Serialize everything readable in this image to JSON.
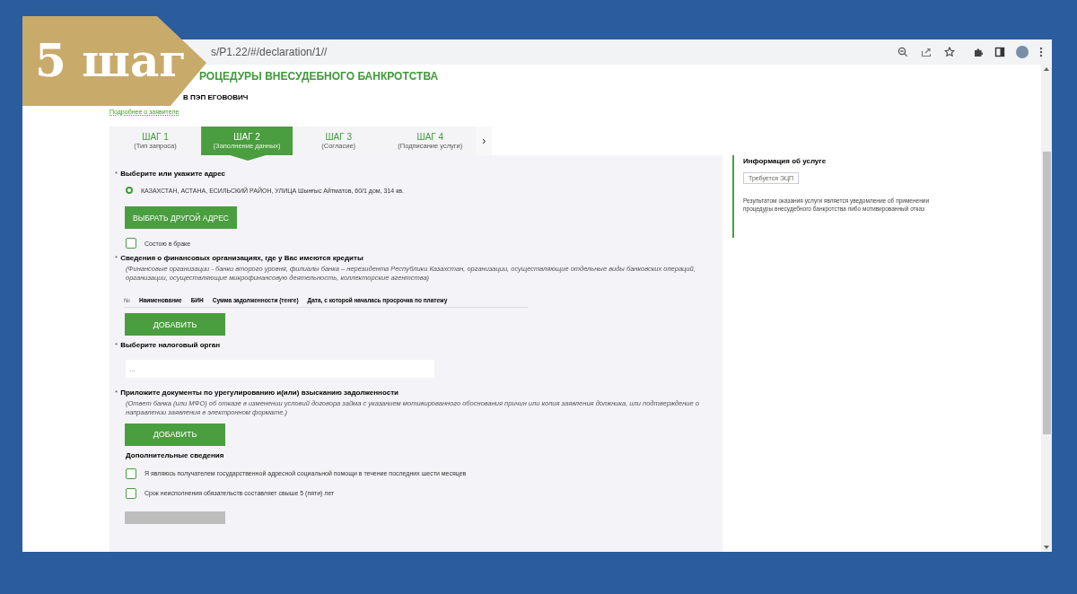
{
  "banner": {
    "text": "5 шаг"
  },
  "browser": {
    "url": "s/P1.22/#/declaration/1//"
  },
  "header": {
    "title": "РОЦЕДУРЫ ВНЕСУДЕБНОГО БАНКРОТСТВА",
    "applicant": "В ПЭП ЕГОВОВИЧ",
    "link": "Подробнее о заявителе"
  },
  "steps": [
    {
      "title": "ШАГ 1",
      "subtitle": "(Тип запроса)",
      "selected": false
    },
    {
      "title": "ШАГ 2",
      "subtitle": "(Заполнение данных)",
      "selected": true
    },
    {
      "title": "ШАГ 3",
      "subtitle": "(Согласие)",
      "selected": false
    },
    {
      "title": "ШАГ 4",
      "subtitle": "(Подписание услуги)",
      "selected": false
    }
  ],
  "steps_next": "›",
  "address": {
    "required": "*",
    "label": "Выберите или укажите адрес",
    "option": "КАЗАХСТАН, АСТАНА, ЕСИЛЬСКИЙ РАЙОН, УЛИЦА Шынғыс Айтматов, 60/1 дом, 314 кв.",
    "selected": true,
    "button": "ВЫБРАТЬ ДРУГОЙ АДРЕС"
  },
  "married": {
    "label": "Состою в браке",
    "checked": false
  },
  "creditors": {
    "required": "*",
    "label": "Сведения о финансовых организациях, где у Вас имеются кредиты",
    "note": "(Финансовые организации - банки второго уровня, филиалы банка – нерезидента Республики Казахстан, организации, осуществляющие отдельные виды банковских операций, организации, осуществляющие микрофинансовую деятельность, коллекторские агентства)",
    "columns": [
      "№",
      "Наименование",
      "БИН",
      "Сумма задолженности (тенге)",
      "Дата, с которой началась просрочка по платежу"
    ],
    "button": "ДОБАВИТЬ"
  },
  "tax": {
    "required": "*",
    "label": "Выберите налоговый орган",
    "placeholder": "..."
  },
  "documents": {
    "required": "*",
    "label": "Приложите документы по урегулированию и(или) взысканию задолженности",
    "note": "(Ответ банка (или МФО) об отказе в изменении условий договора займа с указанием мотивированного обоснования причин или копия заявления должника, или подтверждение о направлении заявления в электронном формате.)",
    "button": "ДОБАВИТЬ"
  },
  "additional": {
    "label": "Дополнительные сведения",
    "options": [
      {
        "label": "Я являюсь получателем государственной адресной социальной помощи в течение последних шести месяцев",
        "checked": false
      },
      {
        "label": "Срок неисполнения обязательств составляет свыше 5 (пяти) лет",
        "checked": false
      }
    ]
  },
  "info": {
    "title": "Информация об услуге",
    "badge": "Требуется ЭЦП",
    "text": "Результатом оказания услуги является уведомление об применении процедуры внесудебного банкротства либо мотивированный отказ"
  }
}
